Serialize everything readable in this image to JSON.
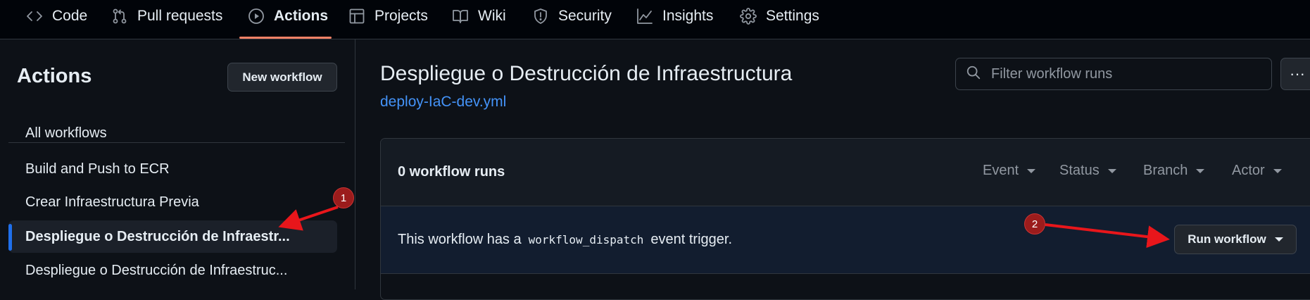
{
  "repo_nav": {
    "tabs": [
      {
        "label": "Code",
        "icon": "code-icon"
      },
      {
        "label": "Pull requests",
        "icon": "pull-request-icon"
      },
      {
        "label": "Actions",
        "icon": "play-icon",
        "active": true
      },
      {
        "label": "Projects",
        "icon": "table-icon"
      },
      {
        "label": "Wiki",
        "icon": "book-icon"
      },
      {
        "label": "Security",
        "icon": "shield-icon"
      },
      {
        "label": "Insights",
        "icon": "graph-icon"
      },
      {
        "label": "Settings",
        "icon": "gear-icon"
      }
    ]
  },
  "sidebar": {
    "title": "Actions",
    "new_workflow_label": "New workflow",
    "all_workflows": "All workflows",
    "workflows": [
      {
        "label": "Build and Push to ECR"
      },
      {
        "label": "Crear Infraestructura Previa"
      },
      {
        "label": "Despliegue o Destrucción de Infraestr...",
        "selected": true
      },
      {
        "label": "Despliegue o Destrucción de Infraestruc..."
      }
    ]
  },
  "main": {
    "title": "Despliegue o Destrucción de Infraestructura",
    "file": "deploy-IaC-dev.yml",
    "filter_placeholder": "Filter workflow runs",
    "more_label": "···",
    "runs_count": "0 workflow runs",
    "filters": [
      "Event",
      "Status",
      "Branch",
      "Actor"
    ],
    "dispatch": {
      "prefix": "This workflow has a",
      "code": "workflow_dispatch",
      "suffix": "event trigger.",
      "run_button": "Run workflow"
    }
  },
  "annotations": {
    "badge_1": "1",
    "badge_2": "2",
    "color": "#e8161b"
  },
  "colors": {
    "background": "#0d1117",
    "header": "#010409",
    "accent_underline": "#f78166",
    "link": "#4493f8",
    "selected_indicator": "#1f6feb"
  }
}
